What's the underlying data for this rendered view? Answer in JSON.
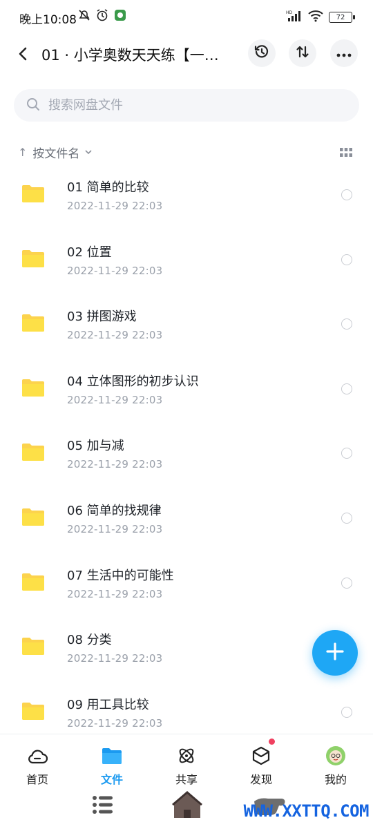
{
  "status": {
    "time": "晚上10:08",
    "battery": "72",
    "network": "HD"
  },
  "header": {
    "title": "01 · 小学奥数天天练【一…"
  },
  "search": {
    "placeholder": "搜索网盘文件"
  },
  "sort": {
    "label": "按文件名"
  },
  "files": [
    {
      "name": "01 简单的比较",
      "date": "2022-11-29  22:03"
    },
    {
      "name": "02 位置",
      "date": "2022-11-29  22:03"
    },
    {
      "name": "03 拼图游戏",
      "date": "2022-11-29  22:03"
    },
    {
      "name": "04 立体图形的初步认识",
      "date": "2022-11-29  22:03"
    },
    {
      "name": "05 加与减",
      "date": "2022-11-29  22:03"
    },
    {
      "name": "06 简单的找规律",
      "date": "2022-11-29  22:03"
    },
    {
      "name": "07 生活中的可能性",
      "date": "2022-11-29  22:03"
    },
    {
      "name": "08 分类",
      "date": "2022-11-29  22:03"
    },
    {
      "name": "09 用工具比较",
      "date": "2022-11-29  22:03"
    }
  ],
  "nav": {
    "home": "首页",
    "files": "文件",
    "share": "共享",
    "discover": "发现",
    "mine": "我的"
  },
  "watermark": "WWW.XXTTQ.COM",
  "colors": {
    "accent": "#1b9af0",
    "folder": "#fcd34d",
    "fab": "#1ea7f5",
    "badge": "#f04060"
  }
}
